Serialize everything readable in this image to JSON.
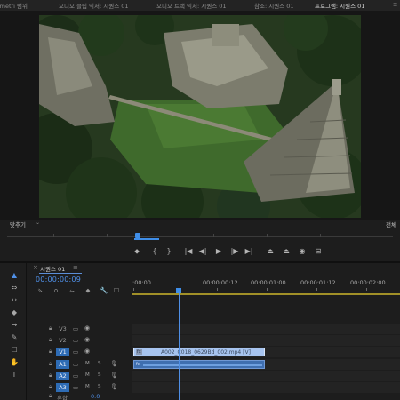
{
  "tabs": [
    {
      "label": "Lumetri 범위",
      "active": false
    },
    {
      "label": "오디오 클립 믹서: 시퀀스 01",
      "active": false
    },
    {
      "label": "오디오 트랙 믹서: 시퀀스 01",
      "active": false
    },
    {
      "label": "참조: 시퀀스 01",
      "active": false
    },
    {
      "label": "프로그램: 시퀀스 01",
      "active": true
    },
    {
      "label": "≡",
      "active": false
    }
  ],
  "program_monitor": {
    "fit_label": "맞추기",
    "fit_chevron": "⌄",
    "full_label": "전체"
  },
  "transport": {
    "marker": "⬥",
    "in_point": "{",
    "out_point": "}",
    "go_to_in": "|◀",
    "step_back": "◀|",
    "play": "▶",
    "step_forward": "|▶",
    "go_to_out": "▶|",
    "lift": "⏏",
    "extract": "⏏",
    "export_frame": "◉",
    "settings": "⊟"
  },
  "tools": [
    "▲",
    "⇔",
    "↔",
    "◆",
    "↦",
    "✎",
    "☐",
    "✋",
    "T"
  ],
  "sequence": {
    "close": "×",
    "name": "시퀀스 01",
    "menu": "≡",
    "timecode": "00:00:00:09"
  },
  "timeline_tools": [
    "⇘",
    "∩",
    "⥊",
    "⬥",
    "🔧",
    "☐"
  ],
  "ruler": {
    "labels": [
      ":00:00",
      "00:00:00:12",
      "00:00:01:00",
      "00:00:01:12",
      "00:00:02:00"
    ]
  },
  "tracks": {
    "video": [
      {
        "name": "V3",
        "target": false
      },
      {
        "name": "V2",
        "target": false
      },
      {
        "name": "V1",
        "target": true
      }
    ],
    "audio": [
      {
        "name": "A1",
        "target": true
      },
      {
        "name": "A2",
        "target": true
      },
      {
        "name": "A3",
        "target": true
      }
    ],
    "mute": "M",
    "solo": "S"
  },
  "clip": {
    "fx": "fx",
    "video_name": "A002_C018_0629Bd_002.mp4 [V]",
    "audio_fx": "fx"
  },
  "master": {
    "name": "혼합",
    "value": "0.0"
  },
  "colors": {
    "accent": "#4f8fe6",
    "video_clip": "#a7c4ef",
    "audio_clip": "#3f6fb0",
    "track_target": "#2e6cb5",
    "work_area": "#b9a42a"
  }
}
